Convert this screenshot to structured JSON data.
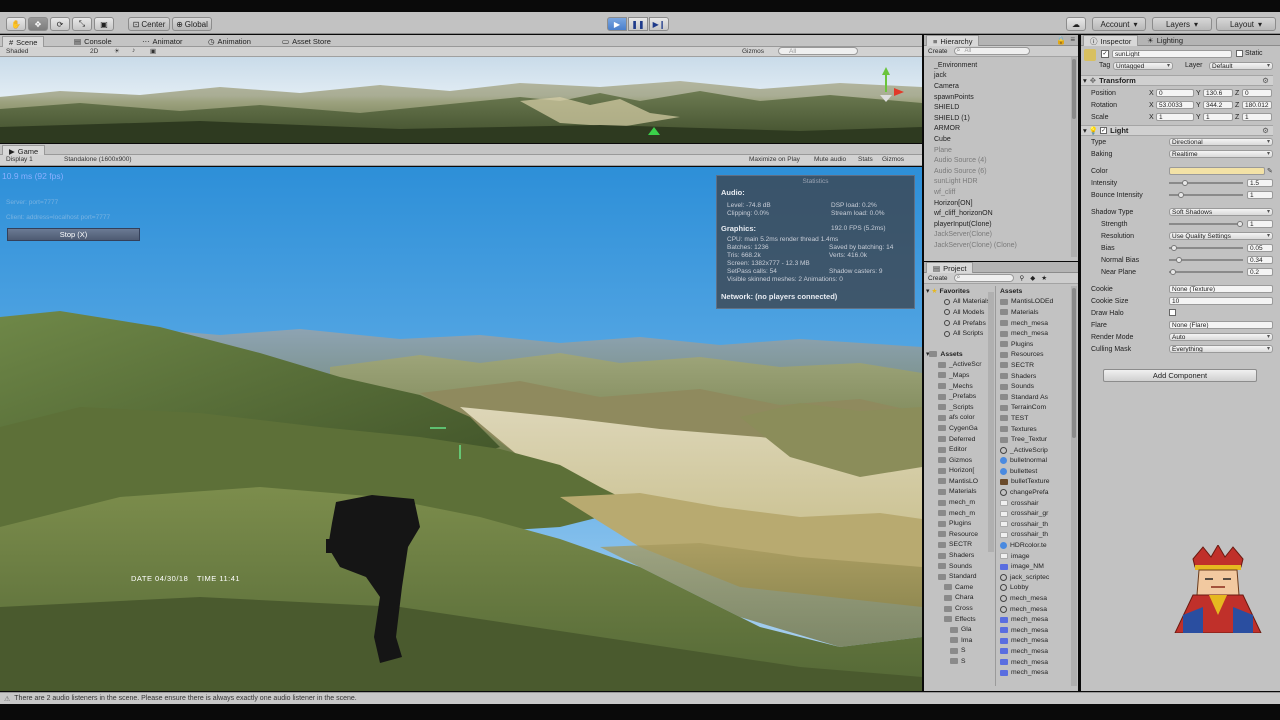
{
  "toolbar": {
    "pivot": "Center",
    "space": "Global",
    "account": "Account",
    "layers": "Layers",
    "layout": "Layout"
  },
  "scene": {
    "tabs": [
      "Scene",
      "Console",
      "Animator",
      "Animation",
      "Asset Store"
    ],
    "shading": "Shaded",
    "mode2d": "2D",
    "gizmos": "Gizmos",
    "search_placeholder": "All"
  },
  "game": {
    "tab": "Game",
    "display": "Display 1",
    "resolution": "Standalone (1600x900)",
    "maximize": "Maximize on Play",
    "mute": "Mute audio",
    "stats": "Stats",
    "gizmos": "Gizmos",
    "fps": "10.9 ms (92 fps)",
    "server": "Server: port=7777",
    "client": "Client: address=localhost port=7777",
    "stop_button": "Stop (X)",
    "date_label": "DATE",
    "date_value": "04/30/18",
    "time_label": "TIME",
    "time_value": "11:41"
  },
  "statistics": {
    "title": "Statistics",
    "audio_heading": "Audio:",
    "level": "Level: -74.8 dB",
    "clipping": "Clipping: 0.0%",
    "dsp_load": "DSP load: 0.2%",
    "stream_load": "Stream load: 0.0%",
    "graphics_heading": "Graphics:",
    "fps": "192.0 FPS (5.2ms)",
    "cpu": "CPU: main 5.2ms  render thread 1.4ms",
    "batches": "Batches: 1236",
    "saved_batching": "Saved by batching: 14",
    "tris": "Tris: 668.2k",
    "verts": "Verts: 416.0k",
    "screen": "Screen: 1382x777 - 12.3 MB",
    "setpass": "SetPass calls: 54",
    "shadow_casters": "Shadow casters: 9",
    "skinned": "Visible skinned meshes: 2  Animations: 0",
    "network": "Network: (no players connected)"
  },
  "hierarchy": {
    "tab": "Hierarchy",
    "create": "Create",
    "search_placeholder": "All",
    "items": [
      {
        "label": "_Environment",
        "style": "normal"
      },
      {
        "label": "jack",
        "style": "normal"
      },
      {
        "label": "Camera",
        "style": "normal"
      },
      {
        "label": "spawnPoints",
        "style": "normal"
      },
      {
        "label": "SHIELD",
        "style": "normal"
      },
      {
        "label": "SHIELD (1)",
        "style": "normal"
      },
      {
        "label": "ARMOR",
        "style": "normal"
      },
      {
        "label": "Cube",
        "style": "normal"
      },
      {
        "label": "Plane",
        "style": "grey"
      },
      {
        "label": "Audio Source (4)",
        "style": "grey"
      },
      {
        "label": "Audio Source (6)",
        "style": "grey"
      },
      {
        "label": "sunLight HDR",
        "style": "grey"
      },
      {
        "label": "wf_cliff",
        "style": "grey"
      },
      {
        "label": "Horizon[ON]",
        "style": "normal"
      },
      {
        "label": "wf_cliff_horizonON",
        "style": "normal"
      },
      {
        "label": "playerInput(Clone)",
        "style": "normal"
      },
      {
        "label": "JackServer(Clone)",
        "style": "grey"
      },
      {
        "label": "JackServer(Clone) (Clone)",
        "style": "grey"
      }
    ]
  },
  "project": {
    "tab": "Project",
    "create": "Create",
    "favorites_label": "Favorites",
    "favorites": [
      "All Materials",
      "All Models",
      "All Prefabs",
      "All Scripts"
    ],
    "assets_label": "Assets",
    "tree": [
      "_ActiveScr",
      "_Maps",
      "_Mechs",
      "_Prefabs",
      "_Scripts",
      "afs color",
      "CygenGa",
      "Deferred",
      "Editor",
      "Gizmos",
      "Horizon[",
      "MantisLO",
      "Materials",
      "mech_m",
      "mech_m",
      "Plugins",
      "Resource",
      "SECTR",
      "Shaders",
      "Sounds",
      "Standard",
      "Came",
      "Chara",
      "Cross",
      "Effects",
      "Gla",
      "Ima",
      "S",
      "S"
    ],
    "assets_header": "Assets",
    "files": [
      {
        "label": "MantisLODEd",
        "icon": "folder"
      },
      {
        "label": "Materials",
        "icon": "folder"
      },
      {
        "label": "mech_mesa",
        "icon": "folder"
      },
      {
        "label": "mech_mesa",
        "icon": "folder"
      },
      {
        "label": "Plugins",
        "icon": "folder"
      },
      {
        "label": "Resources",
        "icon": "folder"
      },
      {
        "label": "SECTR",
        "icon": "folder"
      },
      {
        "label": "Shaders",
        "icon": "folder"
      },
      {
        "label": "Sounds",
        "icon": "folder"
      },
      {
        "label": "Standard As",
        "icon": "folder"
      },
      {
        "label": "TerrainCom",
        "icon": "folder"
      },
      {
        "label": "TEST",
        "icon": "folder"
      },
      {
        "label": "Textures",
        "icon": "folder"
      },
      {
        "label": "Tree_Textur",
        "icon": "folder"
      },
      {
        "label": "_ActiveScrip",
        "icon": "script"
      },
      {
        "label": "bulletnormal",
        "icon": "prefab"
      },
      {
        "label": "bullettest",
        "icon": "prefab"
      },
      {
        "label": "bulletTexture",
        "icon": "brown"
      },
      {
        "label": "changePrefa",
        "icon": "script"
      },
      {
        "label": "crosshair",
        "icon": "white"
      },
      {
        "label": "crosshair_gr",
        "icon": "white"
      },
      {
        "label": "crosshair_th",
        "icon": "white"
      },
      {
        "label": "crosshair_th",
        "icon": "white"
      },
      {
        "label": "HDRcolor.te",
        "icon": "prefab"
      },
      {
        "label": "image",
        "icon": "white"
      },
      {
        "label": "image_NM",
        "icon": "blue"
      },
      {
        "label": "jack_scriptec",
        "icon": "script"
      },
      {
        "label": "Lobby",
        "icon": "script"
      },
      {
        "label": "mech_mesa",
        "icon": "script"
      },
      {
        "label": "mech_mesa",
        "icon": "script"
      },
      {
        "label": "mech_mesa",
        "icon": "blue"
      },
      {
        "label": "mech_mesa",
        "icon": "blue"
      },
      {
        "label": "mech_mesa",
        "icon": "blue"
      },
      {
        "label": "mech_mesa",
        "icon": "blue"
      },
      {
        "label": "mech_mesa",
        "icon": "blue"
      },
      {
        "label": "mech_mesa",
        "icon": "blue"
      }
    ]
  },
  "inspector": {
    "tabs": [
      "Inspector",
      "Lighting"
    ],
    "object_name": "sunLight",
    "static_label": "Static",
    "tag_label": "Tag",
    "tag_value": "Untagged",
    "layer_label": "Layer",
    "layer_value": "Default",
    "transform": {
      "title": "Transform",
      "position_label": "Position",
      "position": {
        "x": "0",
        "y": "130.6",
        "z": "0"
      },
      "rotation_label": "Rotation",
      "rotation": {
        "x": "53.0033",
        "y": "344.2",
        "z": "180.012"
      },
      "scale_label": "Scale",
      "scale": {
        "x": "1",
        "y": "1",
        "z": "1"
      }
    },
    "light": {
      "title": "Light",
      "type_label": "Type",
      "type_value": "Directional",
      "baking_label": "Baking",
      "baking_value": "Realtime",
      "color_label": "Color",
      "color_value": "#f3e2a6",
      "intensity_label": "Intensity",
      "intensity_value": "1.5",
      "intensity_fill": 0.19,
      "bounce_label": "Bounce Intensity",
      "bounce_value": "1",
      "bounce_fill": 0.13,
      "shadow_type_label": "Shadow Type",
      "shadow_type_value": "Soft Shadows",
      "strength_label": "Strength",
      "strength_value": "1",
      "strength_fill": 1.0,
      "resolution_label": "Resolution",
      "resolution_value": "Use Quality Settings",
      "bias_label": "Bias",
      "bias_value": "0.05",
      "bias_fill": 0.025,
      "normal_bias_label": "Normal Bias",
      "normal_bias_value": "0.34",
      "normal_bias_fill": 0.11,
      "near_plane_label": "Near Plane",
      "near_plane_value": "0.2",
      "near_plane_fill": 0.01,
      "cookie_label": "Cookie",
      "cookie_value": "None (Texture)",
      "cookie_size_label": "Cookie Size",
      "cookie_size_value": "10",
      "draw_halo_label": "Draw Halo",
      "flare_label": "Flare",
      "flare_value": "None (Flare)",
      "render_mode_label": "Render Mode",
      "render_mode_value": "Auto",
      "culling_label": "Culling Mask",
      "culling_value": "Everything"
    },
    "add_component": "Add Component"
  },
  "status": {
    "message": "There are 2 audio listeners in the scene. Please ensure there is always exactly one audio listener in the scene."
  }
}
